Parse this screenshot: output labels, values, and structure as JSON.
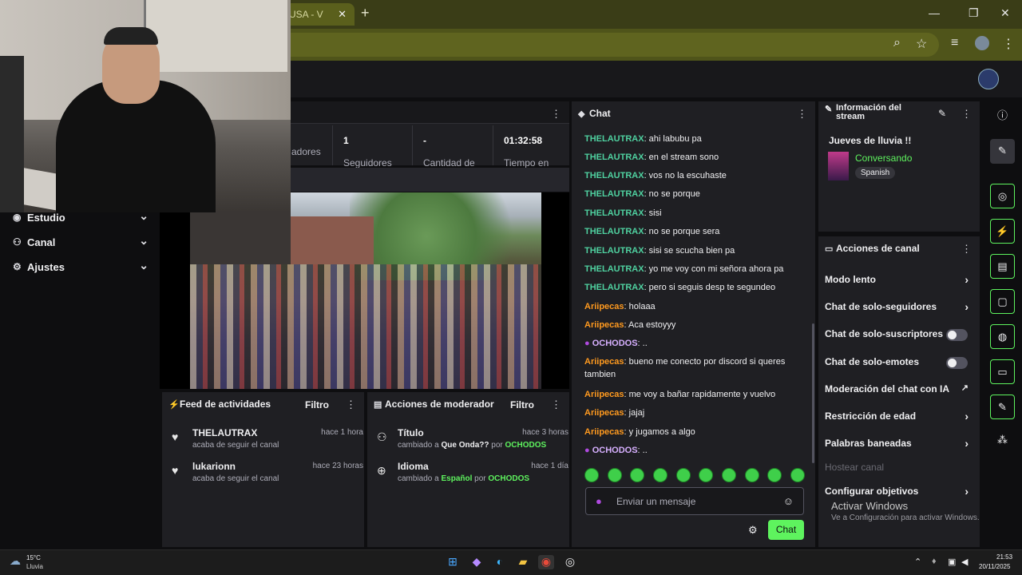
{
  "browser": {
    "tab_title": "USA - V",
    "new_tab": "+",
    "minimize": "—",
    "restore": "❐",
    "close": "✕"
  },
  "nav": {
    "items": [
      {
        "label": "Estudio",
        "icon": "studio-icon"
      },
      {
        "label": "Canal",
        "icon": "channel-icon"
      },
      {
        "label": "Ajustes",
        "icon": "settings-icon"
      }
    ]
  },
  "stats": {
    "items": [
      {
        "value": "",
        "label": "adores"
      },
      {
        "value": "1",
        "label": "Seguidores"
      },
      {
        "value": "-",
        "label": "Cantidad de"
      },
      {
        "value": "01:32:58",
        "label": "Tiempo en"
      }
    ]
  },
  "activity_feed": {
    "title": "Feed de actividades",
    "filter": "Filtro",
    "items": [
      {
        "name": "THELAUTRAX",
        "time": "hace 1 hora",
        "desc": "acaba de seguir el canal"
      },
      {
        "name": "lukarionn",
        "time": "hace 23 horas",
        "desc": "acaba de seguir el canal"
      }
    ]
  },
  "mod_actions": {
    "title": "Acciones de moderador",
    "filter": "Filtro",
    "items": [
      {
        "name": "Título",
        "time": "hace 3 horas",
        "prefix": "cambiado a ",
        "value": "Que Onda??",
        "by": " por ",
        "user": "OCHODOS"
      },
      {
        "name": "Idioma",
        "time": "hace 1 día",
        "prefix": "cambiado a ",
        "value": "Español",
        "by": " por ",
        "user": "OCHODOS"
      }
    ]
  },
  "chat": {
    "title": "Chat",
    "placeholder": "Enviar un mensaje",
    "send": "Chat",
    "messages": [
      {
        "user": "THELAUTRAX",
        "text": ": ahi labubu pa",
        "cls": "u1"
      },
      {
        "user": "THELAUTRAX",
        "text": ": en el stream sono",
        "cls": "u1"
      },
      {
        "user": "THELAUTRAX",
        "text": ": vos no la escuhaste",
        "cls": "u1"
      },
      {
        "user": "THELAUTRAX",
        "text": ": no se porque",
        "cls": "u1"
      },
      {
        "user": "THELAUTRAX",
        "text": ": sisi",
        "cls": "u1"
      },
      {
        "user": "THELAUTRAX",
        "text": ": no se porque sera",
        "cls": "u1"
      },
      {
        "user": "THELAUTRAX",
        "text": ": sisi se scucha bien pa",
        "cls": "u1"
      },
      {
        "user": "THELAUTRAX",
        "text": ": yo me voy con mi señora ahora pa",
        "cls": "u1"
      },
      {
        "user": "THELAUTRAX",
        "text": ": pero si seguis desp te segundeo",
        "cls": "u1"
      },
      {
        "user": "Ariipecas",
        "text": ": holaaa",
        "cls": "u2"
      },
      {
        "user": "Ariipecas",
        "text": ": Aca estoyyy",
        "cls": "u2"
      },
      {
        "user": "OCHODOS",
        "text": ": ..",
        "cls": "u3"
      },
      {
        "user": "Ariipecas",
        "text": ": bueno me conecto por discord si queres tambien",
        "cls": "u2"
      },
      {
        "user": "Ariipecas",
        "text": ": me voy a bañar rapidamente y vuelvo",
        "cls": "u2"
      },
      {
        "user": "Ariipecas",
        "text": ": jajaj",
        "cls": "u2"
      },
      {
        "user": "Ariipecas",
        "text": ": y jugamos a algo",
        "cls": "u2"
      },
      {
        "user": "OCHODOS",
        "text": ": ..",
        "cls": "u3"
      }
    ]
  },
  "stream_info": {
    "title": "Información del stream",
    "stream_title": "Jueves de lluvia !!",
    "category": "Conversando",
    "language": "Spanish"
  },
  "channel_actions": {
    "title": "Acciones de canal",
    "items": [
      {
        "label": "Modo lento",
        "control": "chevron"
      },
      {
        "label": "Chat de solo-seguidores",
        "control": "chevron"
      },
      {
        "label": "Chat de solo-suscriptores",
        "control": "toggle"
      },
      {
        "label": "Chat de solo-emotes",
        "control": "toggle"
      },
      {
        "label": "Moderación del chat con IA",
        "control": "external"
      },
      {
        "label": "Restricción de edad",
        "control": "chevron"
      },
      {
        "label": "Palabras baneadas",
        "control": "chevron"
      },
      {
        "label": "Hostear canal",
        "control": "none"
      },
      {
        "label": "Configurar objetivos",
        "control": "chevron"
      }
    ]
  },
  "watermark": {
    "line1": "Activar Windows",
    "line2": "Ve a Configuración para activar Windows."
  },
  "taskbar": {
    "temp": "15°C",
    "weather": "Lluvia",
    "time": "21:53",
    "date": "20/11/2025"
  },
  "colors": {
    "accent": "#5ef35e",
    "chat_user1": "#4fd1a0",
    "chat_user2": "#ff9a1f",
    "chat_user3": "#d7b0ff"
  }
}
